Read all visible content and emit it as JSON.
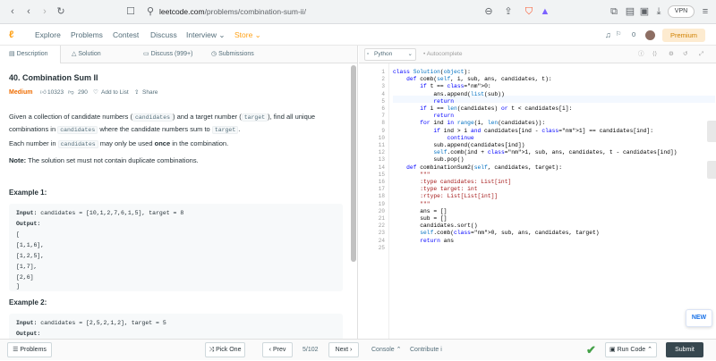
{
  "browser": {
    "url_domain": "leetcode.com",
    "url_path": "/problems/combination-sum-ii/",
    "vpn_label": "VPN",
    "brave_badge": "3"
  },
  "nav": {
    "items": [
      "Explore",
      "Problems",
      "Contest",
      "Discuss",
      "Interview ⌄",
      "Store ⌄"
    ],
    "notification_count": "0",
    "premium_label": "Premium"
  },
  "left_tabs": [
    "Description",
    "Solution",
    "Discuss (999+)",
    "Submissions"
  ],
  "problem": {
    "title": "40. Combination Sum II",
    "difficulty": "Medium",
    "likes": "10323",
    "dislikes": "290",
    "add_to_list": "Add to List",
    "share": "Share",
    "p1_a": "Given a collection of candidate numbers (",
    "p1_code1": "candidates",
    "p1_b": ") and a target number (",
    "p1_code2": "target",
    "p1_c": "), find all unique",
    "p1_d": "combinations in",
    "p1_code3": "candidates",
    "p1_e": "where the candidate numbers sum to",
    "p1_code4": "target",
    "p1_f": ".",
    "p2_a": "Each number in",
    "p2_code": "candidates",
    "p2_b": "may only be used",
    "p2_bold": "once",
    "p2_c": "in the combination.",
    "note_label": "Note:",
    "note_text": "The solution set must not contain duplicate combinations.",
    "example1_title": "Example 1:",
    "example1_lines": [
      "Input: candidates = [10,1,2,7,6,1,5], target = 8",
      "Output:",
      "[",
      "[1,1,6],",
      "[1,2,5],",
      "[1,7],",
      "[2,6]",
      "]"
    ],
    "example2_title": "Example 2:",
    "example2_lines": [
      "Input: candidates = [2,5,2,1,2], target = 5",
      "Output:"
    ]
  },
  "editor": {
    "language": "Python",
    "autocomplete": "Autocomplete",
    "line_numbers": [
      "1",
      "2",
      "3",
      "4",
      "5",
      "6",
      "7",
      "8",
      "9",
      "10",
      "11",
      "12",
      "13",
      "14",
      "15",
      "16",
      "17",
      "18",
      "19",
      "20",
      "21",
      "22",
      "23",
      "24",
      "25"
    ],
    "code_lines": [
      "class Solution(object):",
      "    def comb(self, i, sub, ans, candidates, t):",
      "        if t == 0:",
      "            ans.append(list(sub))",
      "            return",
      "        if i == len(candidates) or t < candidates[i]:",
      "            return",
      "        for ind in range(i, len(candidates)):",
      "            if ind > i and candidates[ind - 1] == candidates[ind]:",
      "                continue",
      "            sub.append(candidates[ind])",
      "            self.comb(ind + 1, sub, ans, candidates, t - candidates[ind])",
      "            sub.pop()",
      "    def combinationSum2(self, candidates, target):",
      "        \"\"\"",
      "        :type candidates: List[int]",
      "        :type target: int",
      "        :rtype: List[List[int]]",
      "        \"\"\"",
      "        ans = []",
      "        sub = []",
      "        candidates.sort()",
      "        self.comb(0, sub, ans, candidates, target)",
      "        return ans",
      ""
    ],
    "new_badge": "NEW"
  },
  "bottom": {
    "problems_label": "Problems",
    "pick_one": "Pick One",
    "prev": "Prev",
    "page": "5/102",
    "next": "Next",
    "console": "Console ⌃",
    "contribute": "Contribute i",
    "run_code": "Run Code ⌃",
    "submit": "Submit"
  },
  "colors": {
    "accent": "#ffa116",
    "medium": "#ef6c00",
    "success": "#43a047",
    "submit": "#37474f"
  }
}
